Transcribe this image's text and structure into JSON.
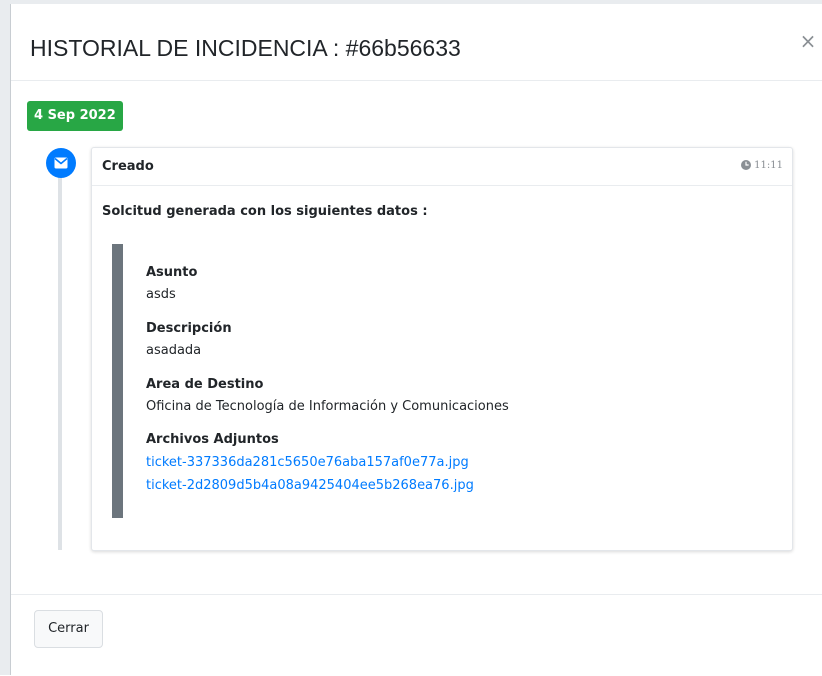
{
  "modal": {
    "title": "HISTORIAL DE INCIDENCIA : #66b56633",
    "close_glyph": "×"
  },
  "timeline": {
    "date_label": "4 Sep 2022",
    "date_label_color": "#28a745",
    "event_icon": "envelope-icon",
    "event_icon_color": "#007bff",
    "entry": {
      "title": "Creado",
      "time": "11:11",
      "time_icon": "clock-icon",
      "intro": "Solcitud generada con los siguientes datos :",
      "fields": {
        "asunto_label": "Asunto",
        "asunto_value": "asds",
        "descripcion_label": "Descripción",
        "descripcion_value": "asadada",
        "area_label": "Area de Destino",
        "area_value": "Oficina de Tecnología de Información y Comunicaciones",
        "adjuntos_label": "Archivos Adjuntos"
      },
      "attachments": [
        "ticket-337336da281c5650e76aba157af0e77a.jpg",
        "ticket-2d2809d5b4a08a9425404ee5b268ea76.jpg"
      ]
    }
  },
  "footer": {
    "close_button_label": "Cerrar"
  },
  "colors": {
    "accent_blue": "#007bff",
    "success_green": "#28a745",
    "quote_bar": "#6c757d"
  }
}
